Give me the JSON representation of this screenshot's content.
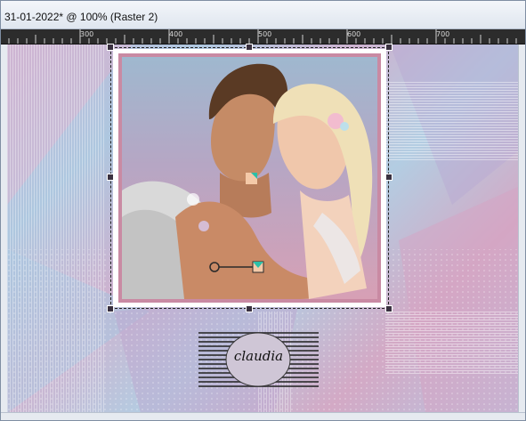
{
  "window": {
    "title": "31-01-2022* @ 100% (Raster 2)"
  },
  "ruler": {
    "labels": [
      "300",
      "400",
      "500",
      "600",
      "700"
    ]
  },
  "canvas": {
    "layer_name": "Raster 2",
    "zoom": "100%",
    "watermark_text": "claudia"
  },
  "colors": {
    "titlebar": "#dfe6ef",
    "ruler": "#2c2c2c",
    "frame_pink": "#c98aa3",
    "canvas_lilac": "#c4b5d6",
    "canvas_blue": "#aec7df"
  },
  "icons": {
    "pick_tool_pivot": "pivot-icon",
    "pick_tool_handle": "rotate-handle-icon"
  }
}
